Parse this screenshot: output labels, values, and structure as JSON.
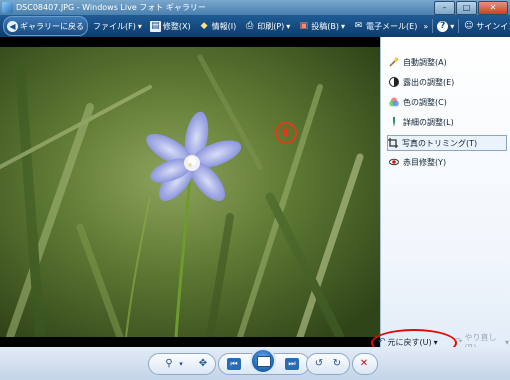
{
  "window": {
    "title": "DSC08407.JPG - Windows Live フォト ギャラリー",
    "signin_label": "サインイン"
  },
  "toolbar": {
    "back_label": "ギャラリーに戻る",
    "file_label": "ファイル(F)",
    "fix_label": "修整(X)",
    "info_label": "情報(I)",
    "print_label": "印刷(P)",
    "publish_label": "投稿(B)",
    "email_label": "電子メール(E)",
    "more_label": "»",
    "help_label": "?"
  },
  "annotation": {
    "step_marker": "⑤"
  },
  "panel": {
    "items": [
      {
        "label": "自動調整(A)",
        "icon": "auto-adjust-icon"
      },
      {
        "label": "露出の調整(E)",
        "icon": "exposure-icon"
      },
      {
        "label": "色の調整(C)",
        "icon": "color-icon"
      },
      {
        "label": "詳細の調整(L)",
        "icon": "detail-icon"
      },
      {
        "label": "写真のトリミング(T)",
        "icon": "crop-icon"
      },
      {
        "label": "赤目修整(Y)",
        "icon": "red-eye-icon"
      }
    ],
    "undo_label": "元に戻す(U)",
    "redo_label": "やり直し(R)"
  },
  "colors": {
    "toolbar_bg": "#0d3d6e",
    "highlight_ring": "#e00a0a",
    "step_marker": "#e53b12"
  }
}
